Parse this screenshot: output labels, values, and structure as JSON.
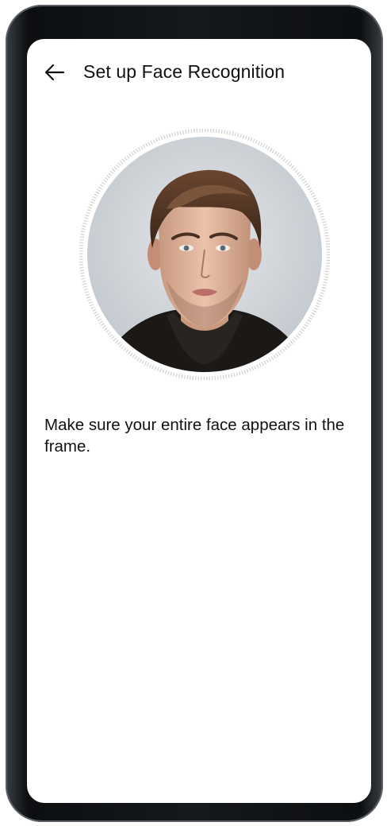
{
  "header": {
    "back_icon": "arrow-left-icon",
    "title": "Set up Face Recognition"
  },
  "camera": {
    "preview_icon": "face-portrait",
    "ring_color": "#d5d5d5",
    "background_color": "#cfd3d8"
  },
  "instruction": {
    "text": "Make sure your entire face appears in the frame."
  }
}
